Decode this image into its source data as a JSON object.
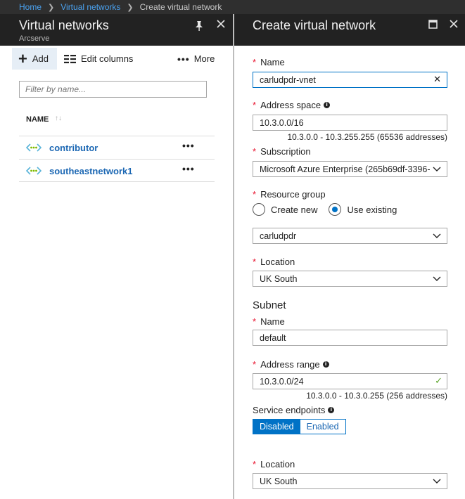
{
  "breadcrumb": {
    "items": [
      "Home",
      "Virtual networks",
      "Create virtual network"
    ]
  },
  "left_blade": {
    "title": "Virtual networks",
    "subtitle": "Arcserve",
    "toolbar": {
      "add_label": "Add",
      "edit_columns_label": "Edit columns",
      "more_label": "More"
    },
    "filter_placeholder": "Filter by name...",
    "column_header": "NAME",
    "rows": [
      {
        "name": "contributor"
      },
      {
        "name": "southeastnetwork1"
      }
    ]
  },
  "right_blade": {
    "title": "Create virtual network",
    "name": {
      "label": "Name",
      "value": "carludpdr-vnet"
    },
    "address_space": {
      "label": "Address space",
      "value": "10.3.0.0/16",
      "hint": "10.3.0.0 - 10.3.255.255 (65536 addresses)"
    },
    "subscription": {
      "label": "Subscription",
      "value": "Microsoft Azure Enterprise (265b69df-3396-"
    },
    "resource_group": {
      "label": "Resource group",
      "create_new_label": "Create new",
      "use_existing_label": "Use existing",
      "selected": "Use existing",
      "value": "carludpdr"
    },
    "location": {
      "label": "Location",
      "value": "UK South"
    },
    "subnet": {
      "section_title": "Subnet",
      "name": {
        "label": "Name",
        "value": "default"
      },
      "address_range": {
        "label": "Address range",
        "value": "10.3.0.0/24",
        "hint": "10.3.0.0 - 10.3.0.255 (256 addresses)"
      },
      "service_endpoints": {
        "label": "Service endpoints",
        "options": [
          "Disabled",
          "Enabled"
        ],
        "selected": "Disabled"
      }
    },
    "location2": {
      "label": "Location",
      "value": "UK South"
    }
  },
  "colors": {
    "accent": "#0072c6",
    "link": "#1b67b3",
    "required": "#e8112d",
    "header_bg": "#222222",
    "breadcrumb_bg": "#2f2f2f",
    "valid": "#5ca52a"
  },
  "icons": {
    "pin": "pin-icon",
    "close": "close-icon",
    "maximize": "maximize-icon",
    "add": "plus-icon",
    "edit_columns": "columns-icon",
    "more": "ellipsis-icon",
    "vnet": "virtual-network-icon",
    "info": "info-icon",
    "dropdown": "chevron-down-icon",
    "clear": "clear-icon",
    "valid": "checkmark-icon"
  }
}
